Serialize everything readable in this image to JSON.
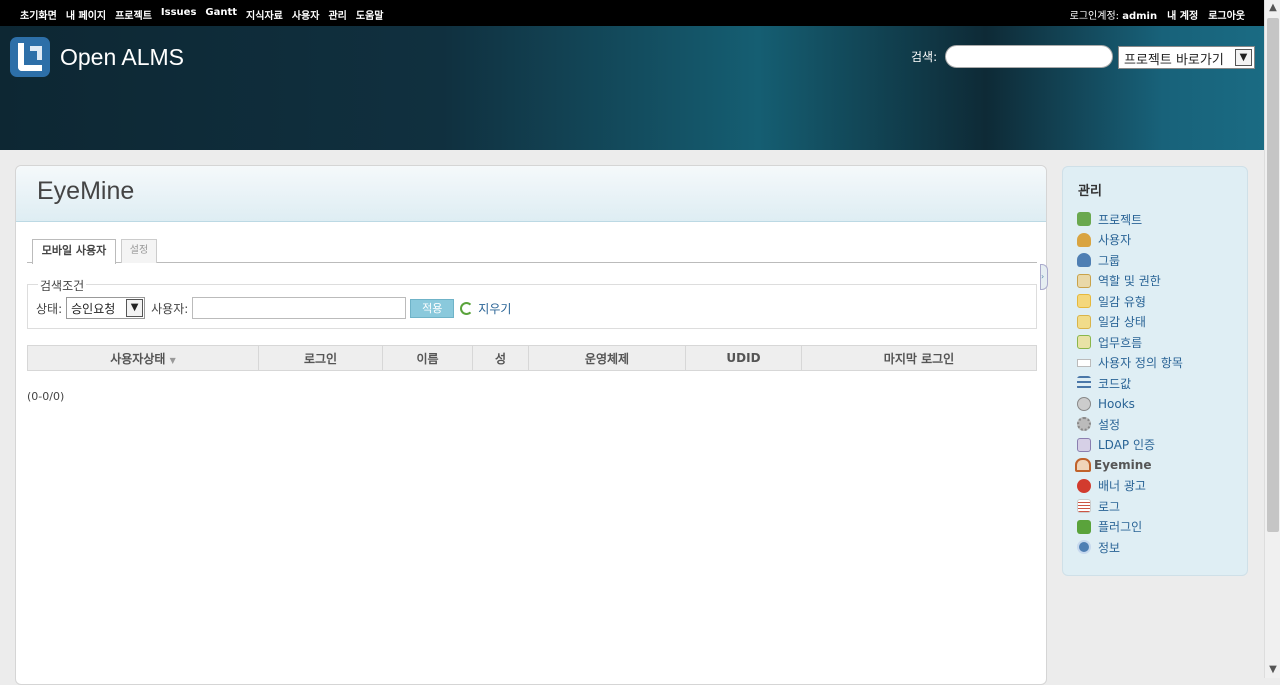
{
  "top_menu": {
    "items": [
      "초기화면",
      "내 페이지",
      "프로젝트",
      "Issues",
      "Gantt",
      "지식자료",
      "사용자",
      "관리",
      "도움말"
    ],
    "account_label": "로그인계정:",
    "account_user": "admin",
    "my_account": "내 계정",
    "logout": "로그아웃"
  },
  "header": {
    "site_title": "Open ALMS",
    "search_label": "검색:",
    "search_value": "",
    "project_jump": "프로젝트 바로가기"
  },
  "content": {
    "title": "EyeMine",
    "tabs": [
      {
        "label": "모바일 사용자"
      },
      {
        "label": "설정"
      }
    ],
    "filter": {
      "legend": "검색조건",
      "status_label": "상태:",
      "status_value": "승인요청",
      "user_label": "사용자:",
      "user_value": "",
      "apply": "적용",
      "clear": "지우기"
    },
    "table": {
      "columns": [
        "사용자상태",
        "로그인",
        "이름",
        "성",
        "운영체제",
        "UDID",
        "마지막 로그인"
      ],
      "sort_indicator": "▼"
    },
    "pagination": "(0-0/0)"
  },
  "sidebar": {
    "title": "관리",
    "items": [
      {
        "label": "프로젝트",
        "icon": "projects-icon",
        "color": "#6aa84f"
      },
      {
        "label": "사용자",
        "icon": "user-icon",
        "color": "#d9a441"
      },
      {
        "label": "그룹",
        "icon": "group-icon",
        "color": "#4f7fb3"
      },
      {
        "label": "역할 및 권한",
        "icon": "roles-icon",
        "color": "#c9a24a"
      },
      {
        "label": "일감 유형",
        "icon": "tracker-icon",
        "color": "#e6b83c"
      },
      {
        "label": "일감 상태",
        "icon": "status-icon",
        "color": "#d9b44a"
      },
      {
        "label": "업무흐름",
        "icon": "workflow-icon",
        "color": "#8bb64a"
      },
      {
        "label": "사용자 정의 항목",
        "icon": "custom-fields-icon",
        "color": "#ffffff"
      },
      {
        "label": "코드값",
        "icon": "enumerations-icon",
        "color": "#4a77a8"
      },
      {
        "label": "Hooks",
        "icon": "hooks-icon",
        "color": "#888888"
      },
      {
        "label": "설정",
        "icon": "settings-icon",
        "color": "#999999"
      },
      {
        "label": "LDAP 인증",
        "icon": "ldap-icon",
        "color": "#8a7fb0"
      },
      {
        "label": "Eyemine",
        "icon": "eyemine-icon",
        "color": "#c0622b"
      },
      {
        "label": "배너 광고",
        "icon": "banner-icon",
        "color": "#d23b2e"
      },
      {
        "label": "로그",
        "icon": "log-icon",
        "color": "#cc5544"
      },
      {
        "label": "플러그인",
        "icon": "plugins-icon",
        "color": "#5aa33b"
      },
      {
        "label": "정보",
        "icon": "info-icon",
        "color": "#4f7fb3"
      }
    ]
  }
}
